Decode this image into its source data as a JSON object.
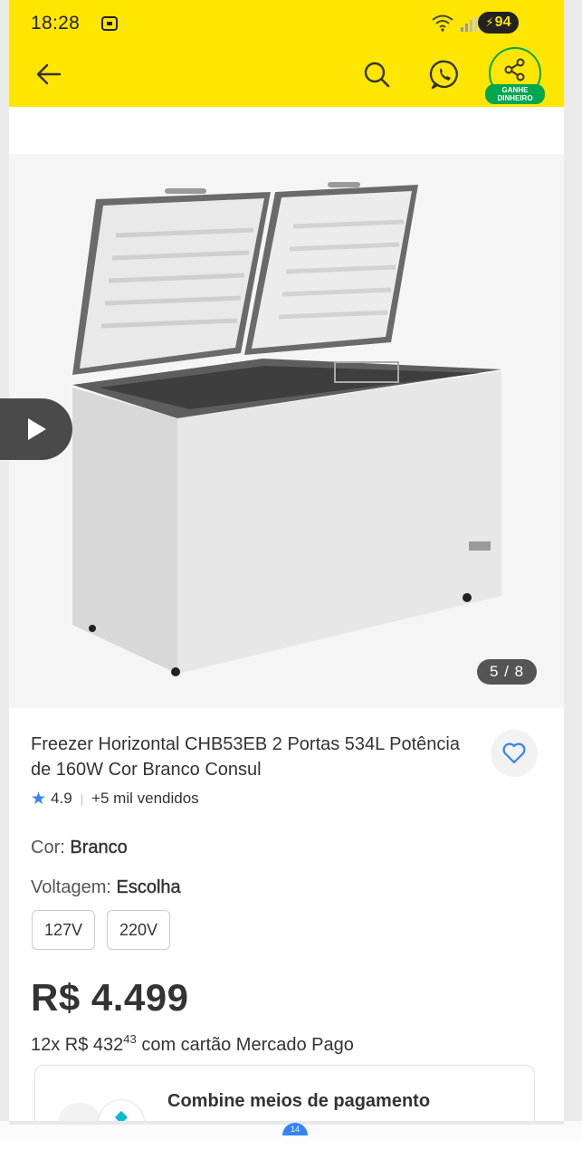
{
  "status_bar": {
    "time": "18:28",
    "battery": "94"
  },
  "header": {
    "back_icon": "arrow-left-icon",
    "search_icon": "search-icon",
    "whatsapp_icon": "whatsapp-icon",
    "share_icon": "share-icon",
    "share_badge_line1": "GANHE",
    "share_badge_line2": "DINHEIRO",
    "accent_color": "#ffe600",
    "badge_color": "#00a650"
  },
  "gallery": {
    "counter": "5 / 8",
    "play_icon": "play-icon"
  },
  "product": {
    "title": "Freezer Horizontal CHB53EB 2 Portas 534L Potência de 160W Cor Branco Consul",
    "rating": "4.9",
    "sold": "+5 mil vendidos",
    "color_label": "Cor:",
    "color_value": "Branco",
    "voltage_label": "Voltagem:",
    "voltage_value": "Escolha",
    "voltage_options": [
      "127V",
      "220V"
    ],
    "price": "R$ 4.499",
    "installments_prefix": "12x R$ 432",
    "installments_cents": "43",
    "installments_suffix": "com cartão Mercado Pago",
    "star_color": "#3483fa"
  },
  "payment_card": {
    "title": "Combine meios de pagamento"
  },
  "bottom_nav": {
    "badge": "14"
  }
}
